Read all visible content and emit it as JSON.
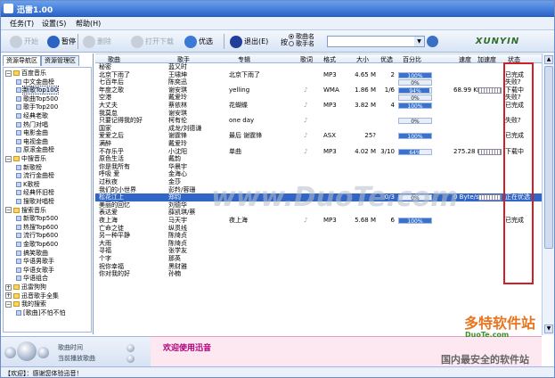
{
  "app": {
    "title": "迅雷1.00",
    "icon": "app-icon"
  },
  "menu": [
    "任务(T)",
    "设置(S)",
    "帮助(H)"
  ],
  "toolbar": {
    "buttons": [
      {
        "label": "开始",
        "icon": "play-icon",
        "enabled": false
      },
      {
        "label": "暂停",
        "icon": "pause-icon",
        "enabled": true
      },
      {
        "label": "删除",
        "icon": "delete-icon",
        "enabled": false
      },
      {
        "label": "打开下载",
        "icon": "open-download-icon",
        "enabled": false
      },
      {
        "label": "优选",
        "icon": "prefer-icon",
        "enabled": true
      },
      {
        "label": "退出(E)",
        "icon": "exit-icon",
        "enabled": true
      }
    ],
    "search": {
      "prefix": "按",
      "options": [
        "歌曲名",
        "歌手名"
      ],
      "selected": "歌曲名",
      "value": "",
      "icon": "search-go-icon"
    },
    "logo_text": "XUNYIN"
  },
  "sidebar": {
    "tabs": [
      "资源导航区",
      "资源管理区"
    ],
    "active_tab": "资源导航区",
    "tree": [
      {
        "label": "百度音乐",
        "level": 0,
        "expander": "−",
        "kind": "folder"
      },
      {
        "label": "中文金曲榜",
        "level": 1,
        "kind": "node"
      },
      {
        "label": "新歌Top100",
        "level": 1,
        "kind": "node",
        "selected": true
      },
      {
        "label": "歌曲Top500",
        "level": 1,
        "kind": "node"
      },
      {
        "label": "歌手Top200",
        "level": 1,
        "kind": "node"
      },
      {
        "label": "经典老歌",
        "level": 1,
        "kind": "node"
      },
      {
        "label": "热门对唱",
        "level": 1,
        "kind": "node"
      },
      {
        "label": "电影金曲",
        "level": 1,
        "kind": "node"
      },
      {
        "label": "电视金曲",
        "level": 1,
        "kind": "node"
      },
      {
        "label": "原滚金曲榜",
        "level": 1,
        "kind": "node"
      },
      {
        "label": "中搜音乐",
        "level": 0,
        "expander": "−",
        "kind": "folder"
      },
      {
        "label": "新歌榜",
        "level": 1,
        "kind": "node"
      },
      {
        "label": "流行金曲榜",
        "level": 1,
        "kind": "node"
      },
      {
        "label": "K歌榜",
        "level": 1,
        "kind": "node"
      },
      {
        "label": "经典怀旧榜",
        "level": 1,
        "kind": "node"
      },
      {
        "label": "搜歌对唱榜",
        "level": 1,
        "kind": "node"
      },
      {
        "label": "搜索音乐",
        "level": 0,
        "expander": "−",
        "kind": "folder"
      },
      {
        "label": "新歌Top500",
        "level": 1,
        "kind": "node"
      },
      {
        "label": "热搜Top600",
        "level": 1,
        "kind": "node"
      },
      {
        "label": "流行Top600",
        "level": 1,
        "kind": "node"
      },
      {
        "label": "金歌Top600",
        "level": 1,
        "kind": "node"
      },
      {
        "label": "搞笑歌曲",
        "level": 1,
        "kind": "node"
      },
      {
        "label": "华语男歌手",
        "level": 1,
        "kind": "node"
      },
      {
        "label": "华语女歌手",
        "level": 1,
        "kind": "node"
      },
      {
        "label": "华语组合",
        "level": 1,
        "kind": "node"
      },
      {
        "label": "迅雷狗狗",
        "level": 0,
        "expander": "+",
        "kind": "folder"
      },
      {
        "label": "迅音歌手全集",
        "level": 0,
        "expander": "+",
        "kind": "folder"
      },
      {
        "label": "我的搜索",
        "level": 0,
        "expander": "−",
        "kind": "folder"
      },
      {
        "label": "[歌曲]不怕不怕",
        "level": 1,
        "kind": "node"
      }
    ]
  },
  "list": {
    "columns": [
      "歌曲",
      "歌手",
      "专辑",
      "歌词",
      "格式",
      "大小",
      "优选",
      "百分比",
      "速度",
      "加速度",
      "状态"
    ],
    "rows": [
      {
        "song": "秘密",
        "singer": "蓝又时",
        "album": "",
        "lyric": "",
        "fmt": "",
        "size": "",
        "pref": "",
        "pct": null,
        "speed": "",
        "status": ""
      },
      {
        "song": "北京下雨了",
        "singer": "王啸坤",
        "album": "北京下雨了",
        "lyric": "",
        "fmt": "MP3",
        "size": "4.65 M",
        "pref": "2",
        "pct": 100,
        "speed": "",
        "status": "已完成"
      },
      {
        "song": "七百年后",
        "singer": "陈奕迅",
        "album": "",
        "lyric": "",
        "fmt": "",
        "size": "",
        "pref": "",
        "pct": 0,
        "speed": "",
        "status": "失败?"
      },
      {
        "song": "年度之歌",
        "singer": "谢安琪",
        "album": "yelling",
        "lyric": "yes",
        "fmt": "WMA",
        "size": "1.86 M",
        "pref": "1/6",
        "pct": 94,
        "speed": "68.99 KB/s",
        "status": "下载中"
      },
      {
        "song": "空港",
        "singer": "戴爱玲",
        "album": "",
        "lyric": "",
        "fmt": "",
        "size": "",
        "pref": "",
        "pct": 0,
        "speed": "",
        "status": "失败?"
      },
      {
        "song": "大丈夫",
        "singer": "蔡依林",
        "album": "花蝴蝶",
        "lyric": "yes",
        "fmt": "MP3",
        "size": "3.82 M",
        "pref": "4",
        "pct": 100,
        "speed": "",
        "status": "已完成"
      },
      {
        "song": "我莫怠",
        "singer": "谢安琪",
        "album": "",
        "lyric": "",
        "fmt": "",
        "size": "",
        "pref": "",
        "pct": null,
        "speed": "",
        "status": ""
      },
      {
        "song": "只要记得我的好",
        "singer": "柯有伦",
        "album": "one day",
        "lyric": "yes",
        "fmt": "",
        "size": "",
        "pref": "",
        "pct": 0,
        "speed": "",
        "status": "失败?"
      },
      {
        "song": "国家",
        "singer": "成龙/刘德谦",
        "album": "",
        "lyric": "",
        "fmt": "",
        "size": "",
        "pref": "",
        "pct": null,
        "speed": "",
        "status": ""
      },
      {
        "song": "爱爱之后",
        "singer": "谢霆锋",
        "album": "最后 谢霆锋",
        "lyric": "yes",
        "fmt": "ASX",
        "size": "25?",
        "pref": "",
        "pct": 100,
        "speed": "",
        "status": "已完成"
      },
      {
        "song": "满醉",
        "singer": "戴爱玲",
        "album": "",
        "lyric": "",
        "fmt": "",
        "size": "",
        "pref": "",
        "pct": null,
        "speed": "",
        "status": ""
      },
      {
        "song": "不存乐乎",
        "singer": "小沈阳",
        "album": "单曲",
        "lyric": "yes",
        "fmt": "MP3",
        "size": "4.02 M",
        "pref": "3/10",
        "pct": 64,
        "speed": "275.28 KB/s",
        "status": "下载中"
      },
      {
        "song": "原色生活",
        "singer": "戴韵",
        "album": "",
        "lyric": "",
        "fmt": "",
        "size": "",
        "pref": "",
        "pct": null,
        "speed": "",
        "status": ""
      },
      {
        "song": "你是我所有",
        "singer": "华晨宇",
        "album": "",
        "lyric": "",
        "fmt": "",
        "size": "",
        "pref": "",
        "pct": null,
        "speed": "",
        "status": ""
      },
      {
        "song": "呼吸 爱",
        "singer": "金海心",
        "album": "",
        "lyric": "",
        "fmt": "",
        "size": "",
        "pref": "",
        "pct": null,
        "speed": "",
        "status": ""
      },
      {
        "song": "过秋夜",
        "singer": "金莎",
        "album": "",
        "lyric": "",
        "fmt": "",
        "size": "",
        "pref": "",
        "pct": null,
        "speed": "",
        "status": ""
      },
      {
        "song": "我们的小世界",
        "singer": "彭羚/蓉珊",
        "album": "",
        "lyric": "",
        "fmt": "",
        "size": "",
        "pref": "",
        "pct": null,
        "speed": "",
        "status": ""
      },
      {
        "song": "松花江上",
        "singer": "郑钧",
        "album": "",
        "lyric": "",
        "fmt": "",
        "size": "",
        "pref": "0/3",
        "pct": 0,
        "speed": "0 Byte/s",
        "status": "正在优选",
        "selected": true
      },
      {
        "song": "美丽的回忆",
        "singer": "刘德华",
        "album": "",
        "lyric": "",
        "fmt": "",
        "size": "",
        "pref": "",
        "pct": null,
        "speed": "",
        "status": ""
      },
      {
        "song": "表达爱",
        "singer": "薛凯琪/蔡",
        "album": "",
        "lyric": "",
        "fmt": "",
        "size": "",
        "pref": "",
        "pct": null,
        "speed": "",
        "status": ""
      },
      {
        "song": "夜上海",
        "singer": "马天宇",
        "album": "夜上海",
        "lyric": "yes",
        "fmt": "MP3",
        "size": "5.68 M",
        "pref": "6",
        "pct": 100,
        "speed": "",
        "status": "已完成"
      },
      {
        "song": "亡命之徒",
        "singer": "纵贯线",
        "album": "",
        "lyric": "",
        "fmt": "",
        "size": "",
        "pref": "",
        "pct": null,
        "speed": "",
        "status": ""
      },
      {
        "song": "另一种平静",
        "singer": "陈绮贞",
        "album": "",
        "lyric": "",
        "fmt": "",
        "size": "",
        "pref": "",
        "pct": null,
        "speed": "",
        "status": ""
      },
      {
        "song": "大雨",
        "singer": "陈绮贞",
        "album": "",
        "lyric": "",
        "fmt": "",
        "size": "",
        "pref": "",
        "pct": null,
        "speed": "",
        "status": ""
      },
      {
        "song": "寻福",
        "singer": "张学友",
        "album": "",
        "lyric": "",
        "fmt": "",
        "size": "",
        "pref": "",
        "pct": null,
        "speed": "",
        "status": ""
      },
      {
        "song": "个字",
        "singer": "那英",
        "album": "",
        "lyric": "",
        "fmt": "",
        "size": "",
        "pref": "",
        "pct": null,
        "speed": "",
        "status": ""
      },
      {
        "song": "祝你幸福",
        "singer": "黑财雅",
        "album": "",
        "lyric": "",
        "fmt": "",
        "size": "",
        "pref": "",
        "pct": null,
        "speed": "",
        "status": ""
      },
      {
        "song": "你对我的好",
        "singer": "孙楠",
        "album": "",
        "lyric": "",
        "fmt": "",
        "size": "",
        "pref": "",
        "pct": null,
        "speed": "",
        "status": ""
      }
    ]
  },
  "player": {
    "time_label": "歌曲时间",
    "now_label": "当前播放歌曲",
    "buttons": [
      "prev-icon",
      "play-icon",
      "next-icon",
      "stop-icon",
      "volume-icon"
    ]
  },
  "notice": "欢迎使用迅音",
  "statusbar": "【欢迎】：感谢您体验迅音！",
  "watermark": {
    "main": "www.DuoTe.com",
    "sub": "多特软件站",
    "sub2": "DuoTe.com",
    "sub3": "国内最安全的软件站"
  },
  "colors": {
    "selection": "#3166c6",
    "progress": "#3a73cf",
    "highlight_box": "#d21f27",
    "notice_text": "#b0007a"
  }
}
